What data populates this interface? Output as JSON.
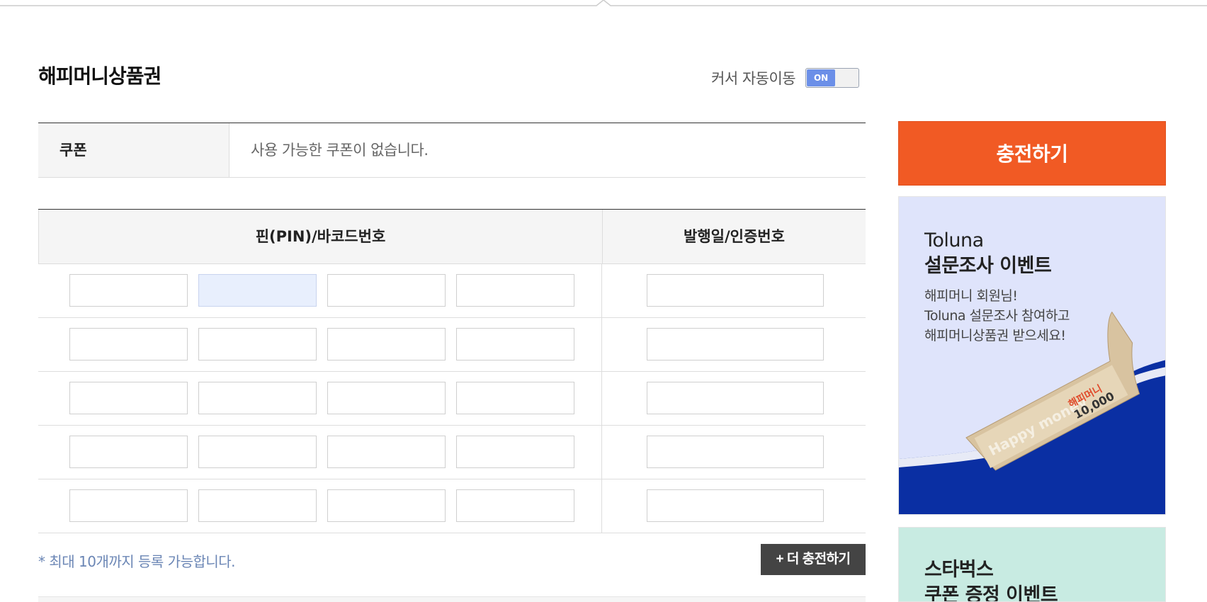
{
  "page": {
    "title": "해피머니상품권"
  },
  "cursor_auto": {
    "label": "커서 자동이동",
    "toggle_text": "ON"
  },
  "coupon": {
    "header": "쿠폰",
    "value": "사용 가능한 쿠폰이 없습니다."
  },
  "pin_table": {
    "col_pin": "핀(PIN)/바코드번호",
    "col_date": "발행일/인증번호",
    "row_count": 5,
    "pins_per_row": 4
  },
  "note": "* 최대 10개까지 등록 가능합니다.",
  "more_button": "+ 더 충전하기",
  "charge_button": "충전하기",
  "banner1": {
    "title_line1": "Toluna",
    "title_line2": "설문조사 이벤트",
    "desc_line1": "해피머니 회원님!",
    "desc_line2": "Toluna 설문조사 참여하고",
    "desc_line3": "해피머니상품권 받으세요!",
    "ticket_brand": "Happy money",
    "ticket_amount": "10,000",
    "ticket_name": "해피머니",
    "bg_color": "#dfe4fb",
    "accent_color": "#0a2fa3"
  },
  "banner2": {
    "title_line1": "스타벅스",
    "title_line2": "쿠폰 증정 이벤트",
    "bg_color": "#c8ebe2"
  },
  "colors": {
    "primary_orange": "#f15a24",
    "toggle_blue": "#6b8fe8",
    "note_blue": "#6b86b5",
    "dark_button": "#444444"
  }
}
